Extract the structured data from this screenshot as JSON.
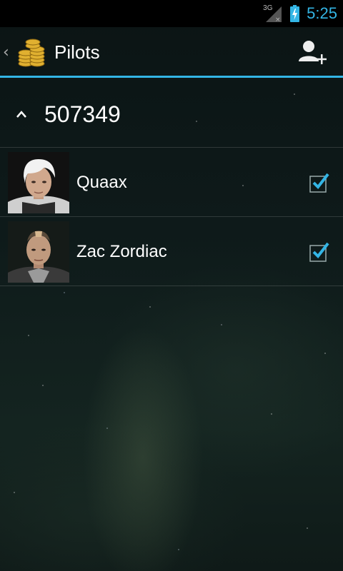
{
  "status_bar": {
    "network_label": "3G",
    "network_icon": "signal-no-data-icon",
    "battery_icon": "battery-charging-icon",
    "time": "5:25",
    "accent_color": "#33b5e5"
  },
  "action_bar": {
    "up_icon": "chevron-left-icon",
    "logo_icon": "isk-coin-stack-icon",
    "title": "Pilots",
    "add_pilot_icon": "add-user-icon"
  },
  "group": {
    "title": "507349",
    "expanded": true,
    "collapse_icon": "chevron-up-icon"
  },
  "pilots": [
    {
      "name": "Quaax",
      "checked": true
    },
    {
      "name": "Zac Zordiac",
      "checked": true
    }
  ]
}
